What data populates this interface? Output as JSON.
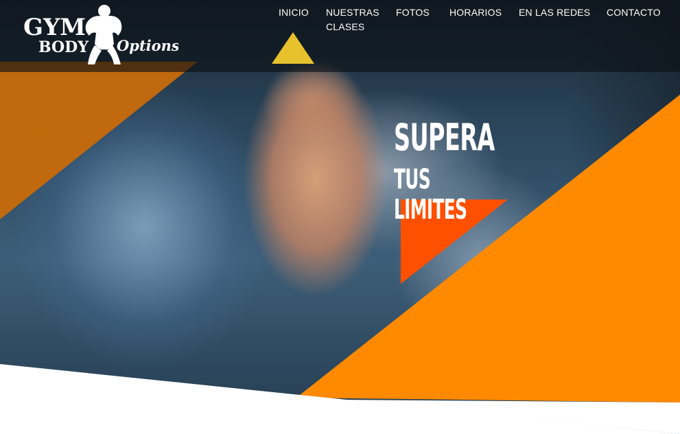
{
  "brand": {
    "logo_line1": "GYM",
    "logo_line2": "BODY",
    "logo_line3": "Options"
  },
  "nav": {
    "items": [
      {
        "label": "INICIO",
        "active": true
      },
      {
        "label": "NUESTRAS CLASES",
        "active": false
      },
      {
        "label": "FOTOS",
        "active": false
      },
      {
        "label": "HORARIOS",
        "active": false
      },
      {
        "label": "EN LAS REDES",
        "active": false
      },
      {
        "label": "CONTACTO",
        "active": false
      }
    ],
    "active_indicator_color": "#e8c22c"
  },
  "hero": {
    "headline_line1": "SUPERA",
    "headline_line2": "TUS LIMITES"
  },
  "colors": {
    "accent_orange": "#ff8a00",
    "accent_dark_orange": "#c76a0a",
    "accent_red_orange": "#ff5000",
    "header_overlay": "#0a0e14",
    "text": "#ffffff"
  }
}
